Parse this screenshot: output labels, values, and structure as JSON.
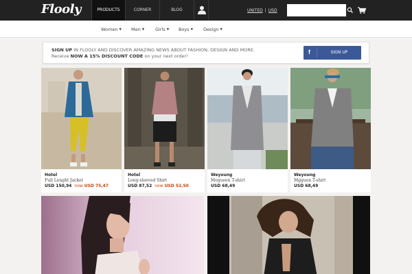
{
  "header": {
    "logo": "Flooly",
    "nav": [
      {
        "label": "PRODUCTS",
        "active": true
      },
      {
        "label": "CORNER",
        "active": false
      },
      {
        "label": "BLOG",
        "active": false
      }
    ],
    "user_icon": "user-icon",
    "locale_country": "UNITED",
    "locale_currency": "USD",
    "search_placeholder": "",
    "search_icon": "search-icon",
    "cart_icon": "cart-icon"
  },
  "categories": [
    {
      "label": "Women"
    },
    {
      "label": "Men"
    },
    {
      "label": "Girls"
    },
    {
      "label": "Boys"
    },
    {
      "label": "Design"
    }
  ],
  "banner": {
    "l1_strong": "SIGN UP",
    "l1_rest": " IN FLOOLY AND DISCOVER AMAZING NEWS ABOUT FASHION, DESIGN AND MORE.",
    "l2_pre": "Receive ",
    "l2_strong": "NOW A 15% DISCOUNT CODE",
    "l2_post": " on your next order!",
    "button_label": "SIGN UP",
    "button_icon": "facebook-icon"
  },
  "products": [
    {
      "brand": "Hotel",
      "name": "Full Lenght Jacket",
      "price": "USD 150,94",
      "sale_prefix": "now",
      "sale_price": "USD 75,47"
    },
    {
      "brand": "Hotel",
      "name": "Long-sleeved Shirt",
      "price": "USD 87,52",
      "sale_prefix": "now",
      "sale_price": "USD 52,50"
    },
    {
      "brand": "Weyoung",
      "name": "Mogueen T-shirt",
      "price": "USD 68,49",
      "sale_prefix": "",
      "sale_price": ""
    },
    {
      "brand": "Weyoung",
      "name": "Mgguen T-shirt",
      "price": "USD 68,49",
      "sale_prefix": "",
      "sale_price": ""
    }
  ],
  "colors": {
    "topbar": "#222222",
    "facebook": "#3b5998",
    "sale": "#c8410b",
    "page_bg": "#f3f2f0"
  }
}
